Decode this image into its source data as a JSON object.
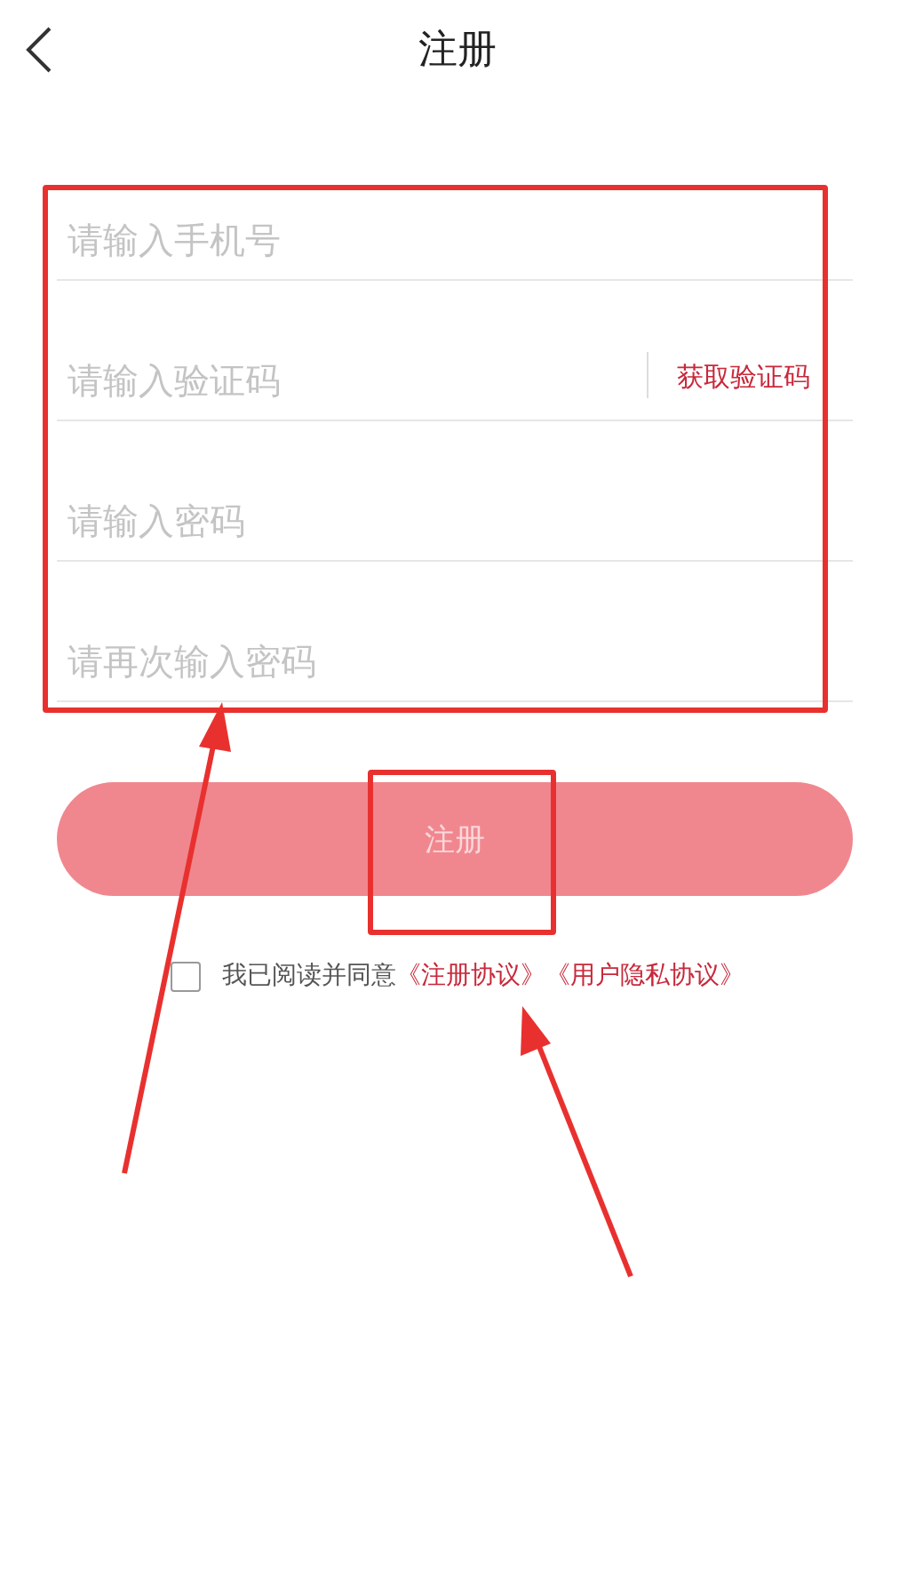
{
  "header": {
    "title": "注册"
  },
  "fields": [
    {
      "kind": "text",
      "placeholder": "请输入手机号"
    },
    {
      "kind": "code",
      "placeholder": "请输入验证码",
      "button": "获取验证码"
    },
    {
      "kind": "password",
      "placeholder": "请输入密码"
    },
    {
      "kind": "password",
      "placeholder": "请再次输入密码"
    }
  ],
  "register_button": {
    "label": "注册",
    "disabled": true
  },
  "agreement": {
    "checked": false,
    "text": "我已阅读并同意",
    "links": [
      "《注册协议》",
      "《用户隐私协议》"
    ]
  }
}
